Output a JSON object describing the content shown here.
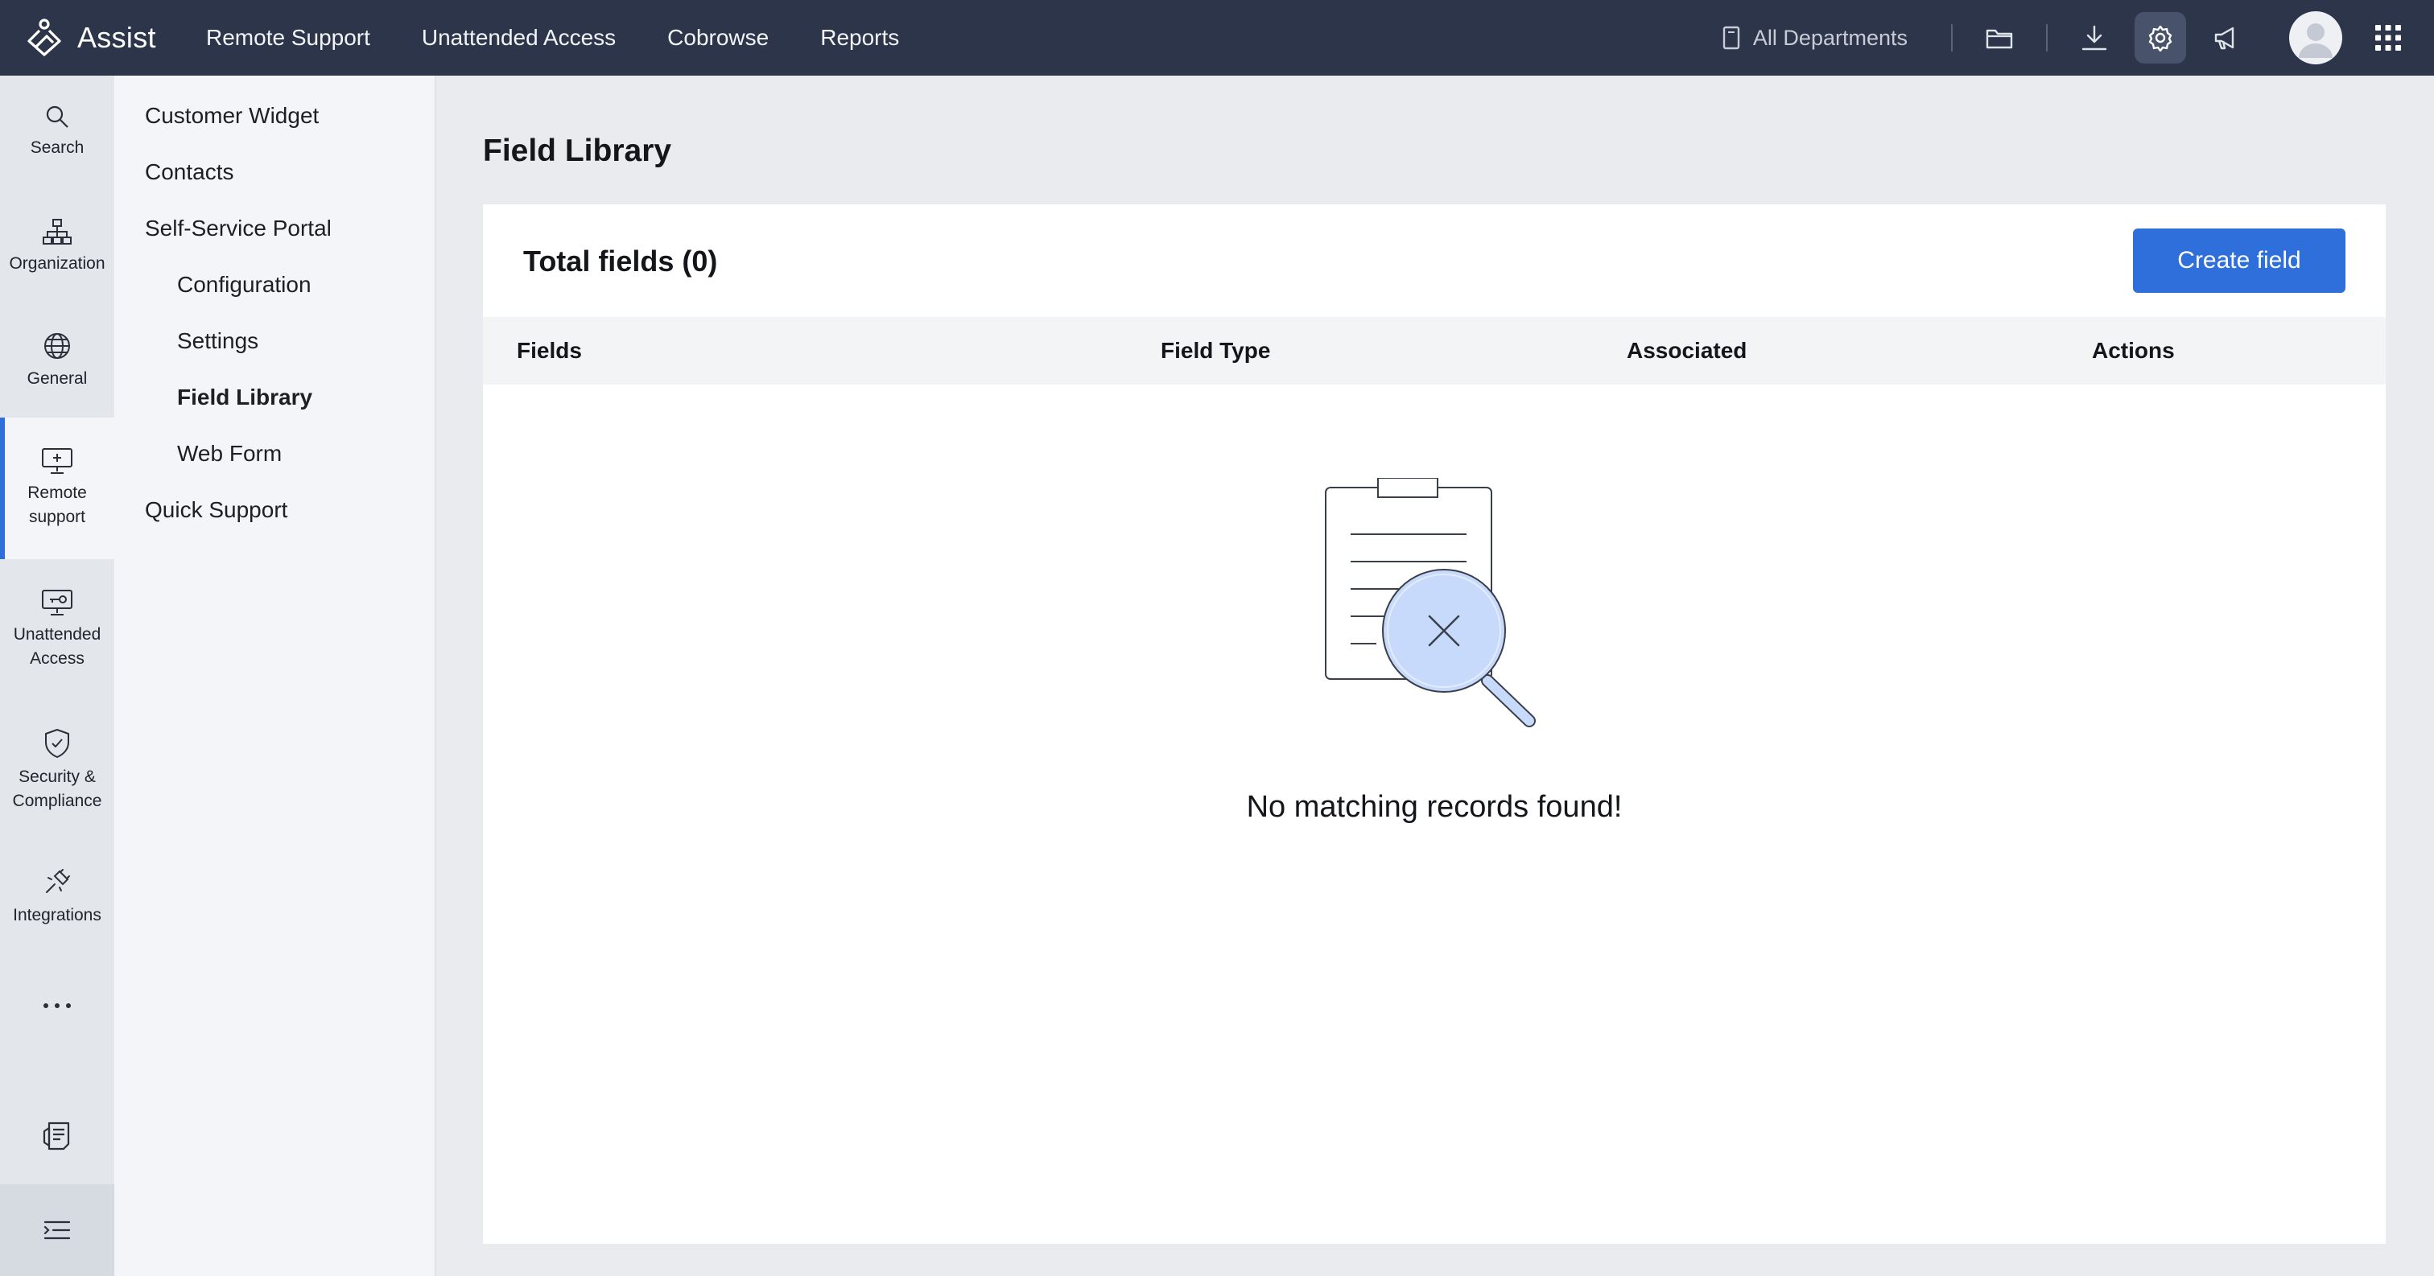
{
  "app": {
    "name": "Assist",
    "brand_color": "#2c3549",
    "accent_color": "#2f6fdc"
  },
  "topnav": {
    "items": [
      {
        "label": "Remote Support"
      },
      {
        "label": "Unattended Access"
      },
      {
        "label": "Cobrowse"
      },
      {
        "label": "Reports"
      }
    ],
    "department": "All Departments",
    "icons": [
      "building-icon",
      "folder-icon",
      "download-icon",
      "settings-icon",
      "announcement-icon",
      "avatar",
      "apps-grid-icon"
    ]
  },
  "rail": {
    "items": [
      {
        "label": "Search",
        "icon": "search-icon"
      },
      {
        "label": "Organization",
        "icon": "org-chart-icon"
      },
      {
        "label": "General",
        "icon": "globe-icon"
      },
      {
        "label_line1": "Remote",
        "label_line2": "support",
        "icon": "monitor-plus-icon",
        "active": true
      },
      {
        "label_line1": "Unattended",
        "label_line2": "Access",
        "icon": "monitor-key-icon"
      },
      {
        "label_line1": "Security &",
        "label_line2": "Compliance",
        "icon": "shield-check-icon"
      },
      {
        "label": "Integrations",
        "icon": "plug-icon"
      },
      {
        "icon": "more-dots-icon"
      },
      {
        "icon": "release-notes-icon"
      },
      {
        "icon": "collapse-menu-icon"
      }
    ]
  },
  "subnav": {
    "items": [
      {
        "label": "Customer Widget",
        "level": 1
      },
      {
        "label": "Contacts",
        "level": 1
      },
      {
        "label": "Self-Service Portal",
        "level": 1
      },
      {
        "label": "Configuration",
        "level": 2
      },
      {
        "label": "Settings",
        "level": 2
      },
      {
        "label": "Field Library",
        "level": 2,
        "selected": true
      },
      {
        "label": "Web Form",
        "level": 2
      },
      {
        "label": "Quick Support",
        "level": 1
      }
    ]
  },
  "main": {
    "title": "Field Library",
    "card_title": "Total fields (0)",
    "create_button": "Create field",
    "columns": [
      "Fields",
      "Field Type",
      "Associated",
      "Actions"
    ],
    "empty_message": "No matching records found!"
  }
}
